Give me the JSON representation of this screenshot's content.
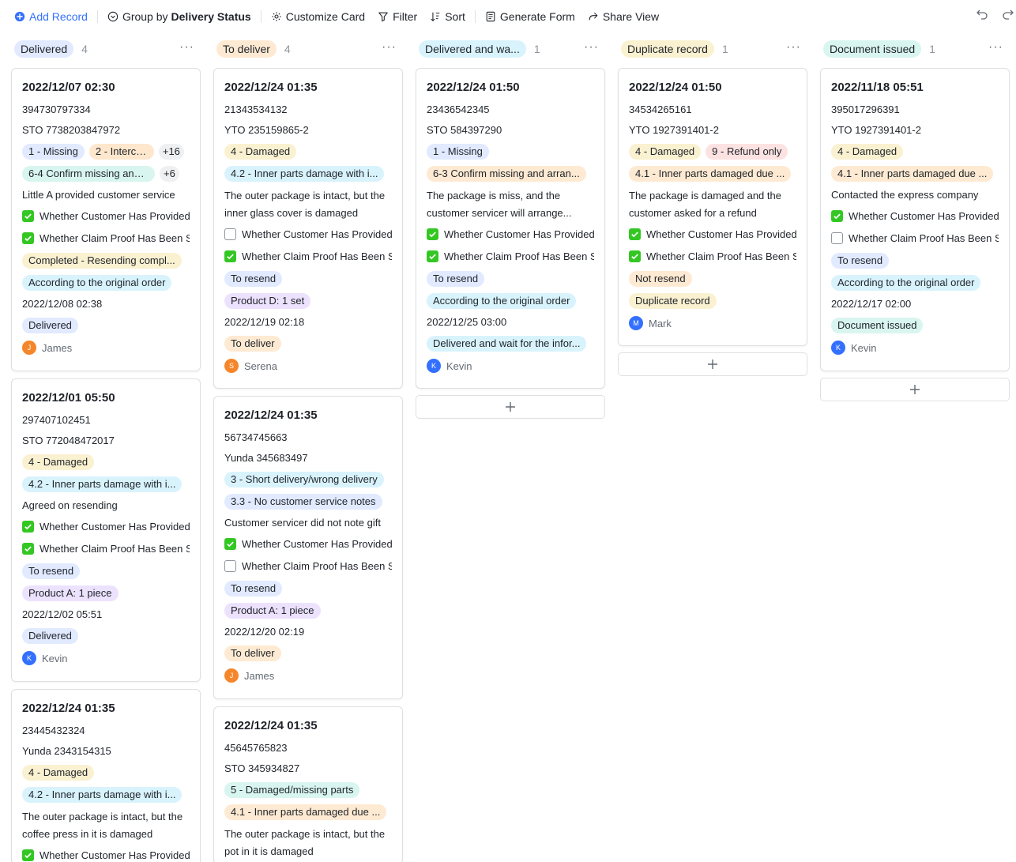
{
  "toolbar": {
    "add_record": "Add Record",
    "group_by_prefix": "Group by",
    "group_by_field": "Delivery Status",
    "customize_card": "Customize Card",
    "filter": "Filter",
    "sort": "Sort",
    "generate_form": "Generate Form",
    "share_view": "Share View"
  },
  "columns": [
    {
      "title": "Delivered",
      "count": "4",
      "more": "···",
      "color": "#e1eaff"
    },
    {
      "title": "To deliver",
      "count": "4",
      "more": "···",
      "color": "#feead2"
    },
    {
      "title": "Delivered and wa...",
      "count": "1",
      "more": "···",
      "color": "#d9f3fd"
    },
    {
      "title": "Duplicate record",
      "count": "1",
      "more": "···",
      "color": "#faf1d1"
    },
    {
      "title": "Document issued",
      "count": "1",
      "more": "···",
      "color": "#d9f5ef"
    }
  ],
  "cards": {
    "c1": {
      "title": "2022/12/07  02:30",
      "order_no": "394730797334",
      "tracking": "STO 7738203847972",
      "tag_a1": "1 - Missing",
      "tag_a2": "2 - Interce...",
      "more_a": "+16",
      "tag_b1": "6-4 Confirm missing and ...",
      "more_b": "+6",
      "note": "Little A provided customer service",
      "check1": "Whether Customer Has Provided Proof",
      "check2": "Whether Claim Proof Has Been Sent",
      "tag_c": "Completed - Resending compl...",
      "tag_d": "According to the original order",
      "date": "2022/12/08  02:38",
      "status": "Delivered",
      "user_initial": "J",
      "user": "James"
    },
    "c2": {
      "title": "2022/12/01  05:50",
      "order_no": "297407102451",
      "tracking": "STO 772048472017",
      "tag_a1": "4 - Damaged",
      "tag_b1": "4.2 - Inner parts damage with i...",
      "note": "Agreed on resending",
      "check1": "Whether Customer Has Provided Proof",
      "check2": "Whether Claim Proof Has Been Sent",
      "tag_c": "To resend",
      "tag_d": "Product A: 1 piece",
      "date": "2022/12/02  05:51",
      "status": "Delivered",
      "user_initial": "K",
      "user": "Kevin"
    },
    "c3": {
      "title": "2022/12/24  01:35",
      "order_no": "23445432324",
      "tracking": "Yunda 2343154315",
      "tag_a1": "4 - Damaged",
      "tag_b1": "4.2 - Inner parts damage with i...",
      "note": "The outer package is intact, but the coffee press in it is damaged",
      "check1": "Whether Customer Has Provided Proof"
    },
    "c4": {
      "title": "2022/12/24  01:35",
      "order_no": "21343534132",
      "tracking": "YTO 235159865-2",
      "tag_a1": "4 - Damaged",
      "tag_b1": "4.2 - Inner parts damage with i...",
      "note": "The outer package is intact, but the inner glass cover is damaged",
      "check1": "Whether Customer Has Provided Proof",
      "check2": "Whether Claim Proof Has Been Sent",
      "tag_c": "To resend",
      "tag_d": "Product D: 1 set",
      "date": "2022/12/19  02:18",
      "status": "To deliver",
      "user_initial": "S",
      "user": "Serena"
    },
    "c5": {
      "title": "2022/12/24  01:35",
      "order_no": "56734745663",
      "tracking": "Yunda 345683497",
      "tag_a1": "3 - Short delivery/wrong delivery",
      "tag_b1": "3.3 - No customer service notes",
      "note": "Customer servicer did not note gift",
      "check1": "Whether Customer Has Provided Proof",
      "check2": "Whether Claim Proof Has Been Sent",
      "tag_c": "To resend",
      "tag_d": "Product A: 1 piece",
      "date": "2022/12/20  02:19",
      "status": "To deliver",
      "user_initial": "J",
      "user": "James"
    },
    "c6": {
      "title": "2022/12/24  01:35",
      "order_no": "45645765823",
      "tracking": "STO 345934827",
      "tag_a1": "5 - Damaged/missing parts",
      "tag_b1": "4.1 - Inner parts damaged due ...",
      "note": "The outer package is intact, but the pot in it is damaged"
    },
    "c7": {
      "title": "2022/12/24  01:50",
      "order_no": "23436542345",
      "tracking": "STO 584397290",
      "tag_a1": "1 - Missing",
      "tag_b1": "6-3 Confirm missing and arran...",
      "note": "The package is miss, and the customer servicer will arrange...",
      "check1": "Whether Customer Has Provided Proof",
      "check2": "Whether Claim Proof Has Been Sent",
      "tag_c": "To resend",
      "tag_d": "According to the original order",
      "date": "2022/12/25  03:00",
      "status": "Delivered and wait for the infor...",
      "user_initial": "K",
      "user": "Kevin"
    },
    "c8": {
      "title": "2022/12/24  01:50",
      "order_no": "34534265161",
      "tracking": "YTO 1927391401-2",
      "tag_a1": "4 - Damaged",
      "tag_a2": "9 - Refund only",
      "tag_b1": "4.1 - Inner parts damaged due ...",
      "note": "The package is damaged and the customer asked for a refund",
      "check1": "Whether Customer Has Provided Proof",
      "check2": "Whether Claim Proof Has Been Sent",
      "tag_c": "Not resend",
      "tag_d": "Duplicate record",
      "user_initial": "M",
      "user": "Mark"
    },
    "c9": {
      "title": "2022/11/18  05:51",
      "order_no": "395017296391",
      "tracking": "YTO 1927391401-2",
      "tag_a1": "4 - Damaged",
      "tag_b1": "4.1 - Inner parts damaged due ...",
      "note": "Contacted the express company",
      "check1": "Whether Customer Has Provided Proof",
      "check2": "Whether Claim Proof Has Been Sent",
      "tag_c": "To resend",
      "tag_d": "According to the original order",
      "date": "2022/12/17  02:00",
      "status": "Document issued",
      "user_initial": "K",
      "user": "Kevin"
    }
  },
  "colors": {
    "accent": "#3370ff",
    "check_on": "#34c724",
    "avatar_orange": "#f5862a",
    "avatar_blue": "#3370ff"
  }
}
